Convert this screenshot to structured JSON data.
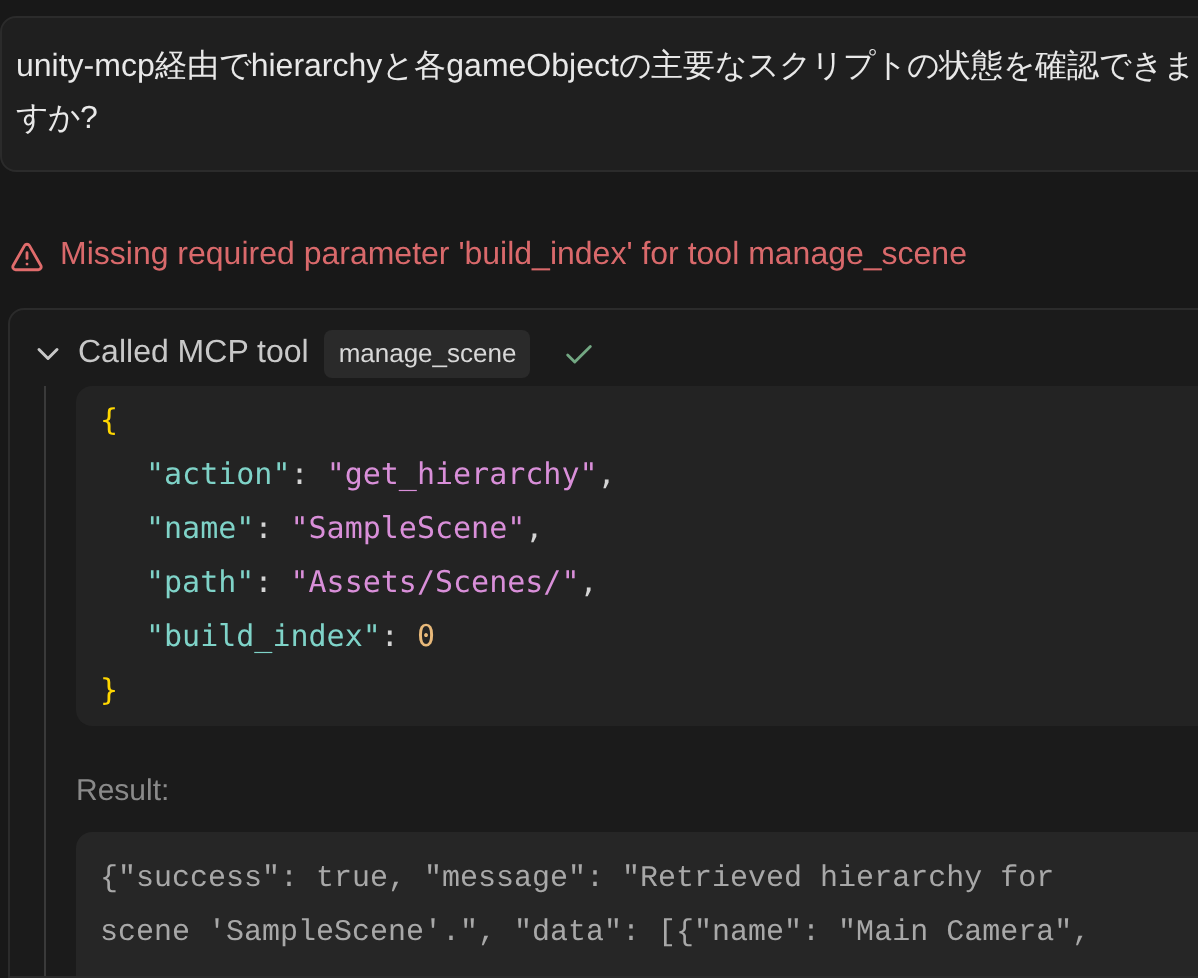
{
  "user_message": "unity-mcp経由でhierarchyと各gameObjectの主要なスクリプトの状態を確認できますか?",
  "error": "Missing required parameter 'build_index' for tool manage_scene",
  "tool_call": {
    "expanded": true,
    "label": "Called MCP tool",
    "tool_name": "manage_scene",
    "succeeded": true,
    "arguments": [
      [
        {
          "kind": "brace",
          "text": "{"
        }
      ],
      [
        {
          "kind": "key",
          "text": "\"action\""
        },
        {
          "kind": "punct",
          "text": ": "
        },
        {
          "kind": "string",
          "text": "\"get_hierarchy\""
        },
        {
          "kind": "punct",
          "text": ","
        }
      ],
      [
        {
          "kind": "key",
          "text": "\"name\""
        },
        {
          "kind": "punct",
          "text": ": "
        },
        {
          "kind": "string",
          "text": "\"SampleScene\""
        },
        {
          "kind": "punct",
          "text": ","
        }
      ],
      [
        {
          "kind": "key",
          "text": "\"path\""
        },
        {
          "kind": "punct",
          "text": ": "
        },
        {
          "kind": "string",
          "text": "\"Assets/Scenes/\""
        },
        {
          "kind": "punct",
          "text": ","
        }
      ],
      [
        {
          "kind": "key",
          "text": "\"build_index\""
        },
        {
          "kind": "punct",
          "text": ": "
        },
        {
          "kind": "number",
          "text": "0"
        }
      ],
      [
        {
          "kind": "brace",
          "text": "}"
        }
      ]
    ],
    "result_label": "Result:",
    "result_lines": [
      "{\"success\": true, \"message\": \"Retrieved hierarchy for",
      "scene 'SampleScene'.\", \"data\": [{\"name\": \"Main Camera\","
    ]
  }
}
